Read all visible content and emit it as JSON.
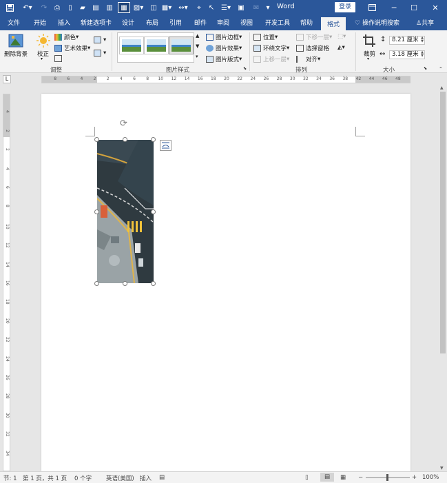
{
  "window": {
    "title": "Word",
    "login_label": "登录",
    "minimize_icon": "minimize-icon",
    "restore_icon": "restore-icon",
    "close_icon": "close-icon"
  },
  "tabs": [
    {
      "label": "文件"
    },
    {
      "label": "开始"
    },
    {
      "label": "插入"
    },
    {
      "label": "新建选项卡"
    },
    {
      "label": "设计"
    },
    {
      "label": "布局"
    },
    {
      "label": "引用"
    },
    {
      "label": "邮件"
    },
    {
      "label": "审阅"
    },
    {
      "label": "视图"
    },
    {
      "label": "开发工具"
    },
    {
      "label": "帮助"
    }
  ],
  "active_tab": "格式",
  "tell_me": "操作说明搜索",
  "share": "共享",
  "ribbon": {
    "adjust": {
      "remove_bg": "删除背景",
      "corrections": "校正",
      "color": "颜色",
      "artistic": "艺术效果",
      "group_label": "调整"
    },
    "styles": {
      "border": "图片边框",
      "effects": "图片效果",
      "layout": "图片版式",
      "group_label": "图片样式"
    },
    "arrange": {
      "position": "位置",
      "wrap": "环绕文字",
      "bring_forward": "上移一层",
      "send_backward": "下移一层",
      "selection_pane": "选择窗格",
      "align": "对齐",
      "group_label": "排列"
    },
    "size": {
      "crop": "裁剪",
      "height": "8.21 厘米",
      "width": "3.18 厘米",
      "group_label": "大小"
    }
  },
  "ruler": {
    "h_numbers": [
      "8",
      "6",
      "4",
      "2",
      "2",
      "4",
      "6",
      "8",
      "10",
      "12",
      "14",
      "16",
      "18",
      "20",
      "22",
      "24",
      "26",
      "28",
      "30",
      "32",
      "34",
      "36",
      "38",
      "42",
      "44",
      "46",
      "48"
    ],
    "v_numbers": [
      "4",
      "2",
      "2",
      "4",
      "6",
      "8",
      "10",
      "12",
      "14",
      "16",
      "18",
      "20",
      "22",
      "24",
      "26",
      "28",
      "30",
      "32",
      "34"
    ]
  },
  "status": {
    "section": "节: 1",
    "page": "第 1 页，共 1 页",
    "words": "0 个字",
    "language": "英语(美国)",
    "mode": "插入",
    "zoom": "100%"
  },
  "colors": {
    "titlebar": "#2b579a",
    "ribbon": "#f3f3f3",
    "workspace": "#e6e6e6"
  }
}
